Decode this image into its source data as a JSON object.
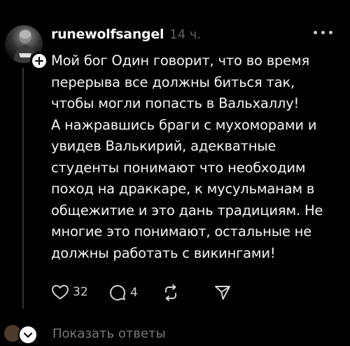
{
  "post": {
    "username": "runewolfsangel",
    "time": "14 ч.",
    "body_lines": [
      "Мой бог Один говорит, что во время",
      "перерыва все должны биться так,",
      "чтобы могли попасть в Вальхаллу!",
      "А нажравшись браги с мухоморами и",
      "увидев Валькирий, адекватные",
      "студенты понимают что необходим",
      "поход на  драккаре, к мусульманам в",
      "общежитие и это дань традициям. Не",
      "многие это понимают, остальные не",
      "должны работать с викингами!"
    ],
    "likes": "32",
    "comments": "4"
  },
  "replies": {
    "label": "Показать ответы"
  },
  "icons": {
    "follow": "plus-icon",
    "more": "more-dots-icon",
    "like": "heart-icon",
    "comment": "comment-icon",
    "repost": "repost-icon",
    "share": "send-icon"
  },
  "colors": {
    "background": "#000000",
    "text": "#f3f5f7",
    "muted": "#616161",
    "thread_line": "#333638"
  }
}
